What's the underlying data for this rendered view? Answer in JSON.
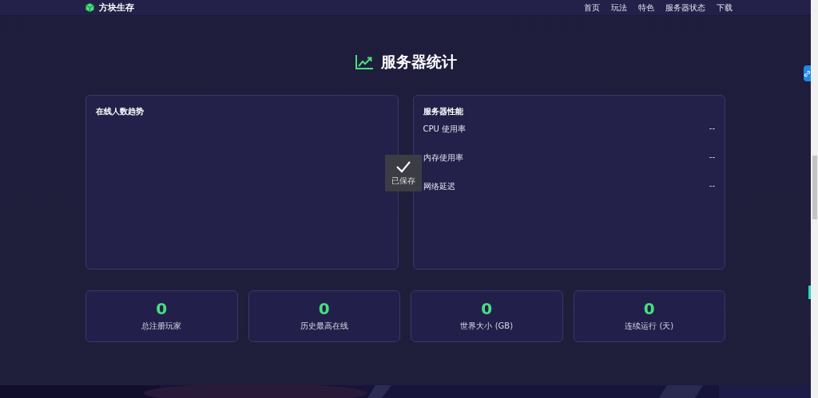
{
  "nav": {
    "brand": "方块生存",
    "links": [
      {
        "label": "首页"
      },
      {
        "label": "玩法"
      },
      {
        "label": "特色"
      },
      {
        "label": "服务器状态"
      },
      {
        "label": "下载"
      }
    ]
  },
  "section": {
    "title": "服务器统计"
  },
  "trend_card": {
    "title": "在线人数趋势"
  },
  "performance_card": {
    "title": "服务器性能",
    "metrics": [
      {
        "label": "CPU 使用率",
        "value": "--"
      },
      {
        "label": "内存使用率",
        "value": "--"
      },
      {
        "label": "网络延迟",
        "value": "--"
      }
    ]
  },
  "stats": [
    {
      "value": "0",
      "label": "总注册玩家"
    },
    {
      "value": "0",
      "label": "历史最高在线"
    },
    {
      "value": "0",
      "label": "世界大小 (GB)"
    },
    {
      "value": "0",
      "label": "连续运行 (天)"
    }
  ],
  "toast": {
    "text": "已保存"
  }
}
